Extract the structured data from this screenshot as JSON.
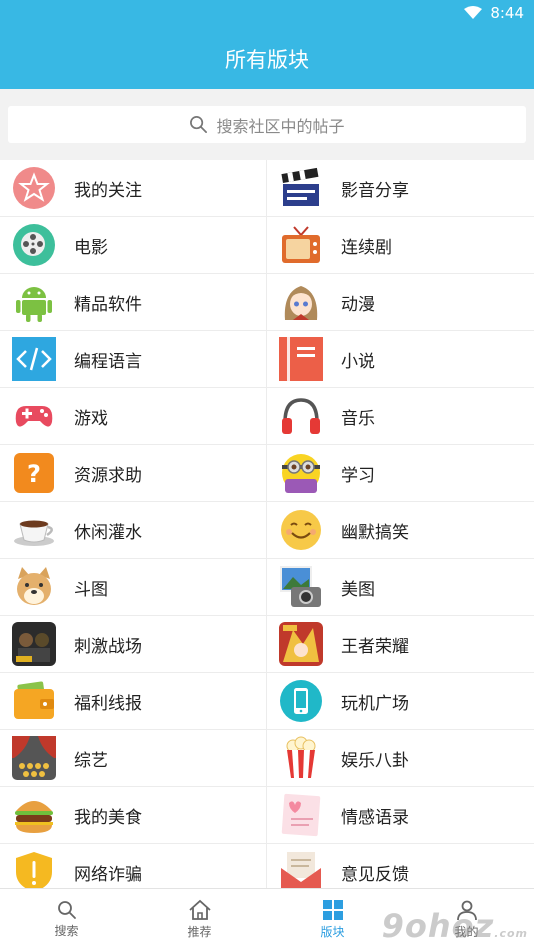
{
  "status_bar": {
    "time": "8:44"
  },
  "header": {
    "title": "所有版块"
  },
  "search": {
    "placeholder": "搜索社区中的帖子"
  },
  "boards": [
    {
      "left": {
        "label": "我的关注",
        "icon": "star-circle-icon"
      },
      "right": {
        "label": "影音分享",
        "icon": "clapperboard-icon"
      }
    },
    {
      "left": {
        "label": "电影",
        "icon": "film-reel-icon"
      },
      "right": {
        "label": "连续剧",
        "icon": "tv-icon"
      }
    },
    {
      "left": {
        "label": "精品软件",
        "icon": "android-icon"
      },
      "right": {
        "label": "动漫",
        "icon": "anime-girl-icon"
      }
    },
    {
      "left": {
        "label": "编程语言",
        "icon": "code-icon"
      },
      "right": {
        "label": "小说",
        "icon": "book-icon"
      }
    },
    {
      "left": {
        "label": "游戏",
        "icon": "gamepad-icon"
      },
      "right": {
        "label": "音乐",
        "icon": "headphones-icon"
      }
    },
    {
      "left": {
        "label": "资源求助",
        "icon": "question-icon"
      },
      "right": {
        "label": "学习",
        "icon": "minion-icon"
      }
    },
    {
      "left": {
        "label": "休闲灌水",
        "icon": "coffee-cup-icon"
      },
      "right": {
        "label": "幽默搞笑",
        "icon": "smiley-icon"
      }
    },
    {
      "left": {
        "label": "斗图",
        "icon": "doge-icon"
      },
      "right": {
        "label": "美图",
        "icon": "photos-camera-icon"
      }
    },
    {
      "left": {
        "label": "刺激战场",
        "icon": "pubg-game-icon"
      },
      "right": {
        "label": "王者荣耀",
        "icon": "honor-of-kings-icon"
      }
    },
    {
      "left": {
        "label": "福利线报",
        "icon": "wallet-icon"
      },
      "right": {
        "label": "玩机广场",
        "icon": "phone-icon"
      }
    },
    {
      "left": {
        "label": "综艺",
        "icon": "theater-icon"
      },
      "right": {
        "label": "娱乐八卦",
        "icon": "popcorn-icon"
      }
    },
    {
      "left": {
        "label": "我的美食",
        "icon": "burger-icon"
      },
      "right": {
        "label": "情感语录",
        "icon": "love-note-icon"
      }
    },
    {
      "left": {
        "label": "网络诈骗",
        "icon": "shield-alert-icon"
      },
      "right": {
        "label": "意见反馈",
        "icon": "envelope-icon"
      }
    }
  ],
  "tabs": [
    {
      "label": "搜索",
      "icon": "search-icon"
    },
    {
      "label": "推荐",
      "icon": "home-icon"
    },
    {
      "label": "版块",
      "icon": "grid-icon",
      "active": true
    },
    {
      "label": "我的",
      "icon": "user-icon"
    }
  ],
  "colors": {
    "primary": "#38b8e4",
    "active_tab": "#2d9ee0"
  },
  "watermark": {
    "text": "9ohoz",
    "suffix": ".com"
  }
}
